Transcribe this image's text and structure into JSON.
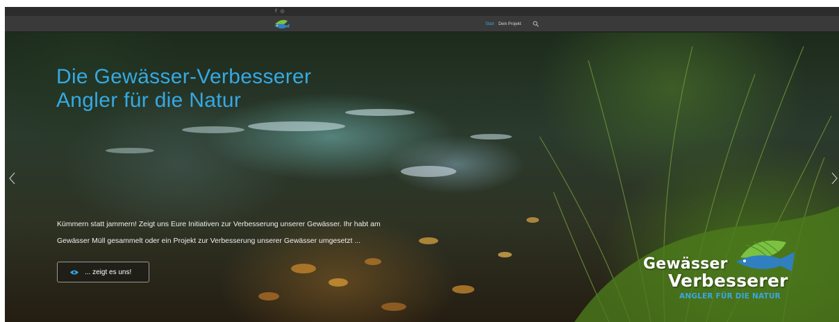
{
  "topbar": {
    "social": [
      {
        "icon": "facebook-icon",
        "glyph": "f"
      },
      {
        "icon": "instagram-icon",
        "glyph": "◎"
      }
    ]
  },
  "nav": {
    "logo_icon": "fish-logo-icon",
    "items": [
      {
        "label": "Start",
        "active": true
      },
      {
        "label": "Dein Projekt",
        "active": false
      }
    ],
    "search_icon": "search-icon"
  },
  "hero": {
    "headline_line1": "Die Gewässer-Verbesserer",
    "headline_line2": "Angler für die Natur",
    "intro_line1": "Kümmern statt jammern! Zeigt uns Eure Initiativen zur Verbesserung unserer Gewässer. Ihr habt am",
    "intro_line2": "Gewässer Müll gesammelt oder ein Projekt zur Verbesserung unserer Gewässer umgesetzt ...",
    "cta_label": "... zeigt es uns!",
    "cta_icon": "eye-icon",
    "prev_icon": "chevron-left-icon",
    "next_icon": "chevron-right-icon"
  },
  "brand": {
    "line1": "Gewässer",
    "line2": "Verbesserer",
    "tagline": "ANGLER FÜR DIE NATUR"
  },
  "colors": {
    "accent": "#35a9e4",
    "topbar": "#2c2c2c",
    "navbar": "#3a3a3a",
    "logo_green": "#7cc242"
  }
}
